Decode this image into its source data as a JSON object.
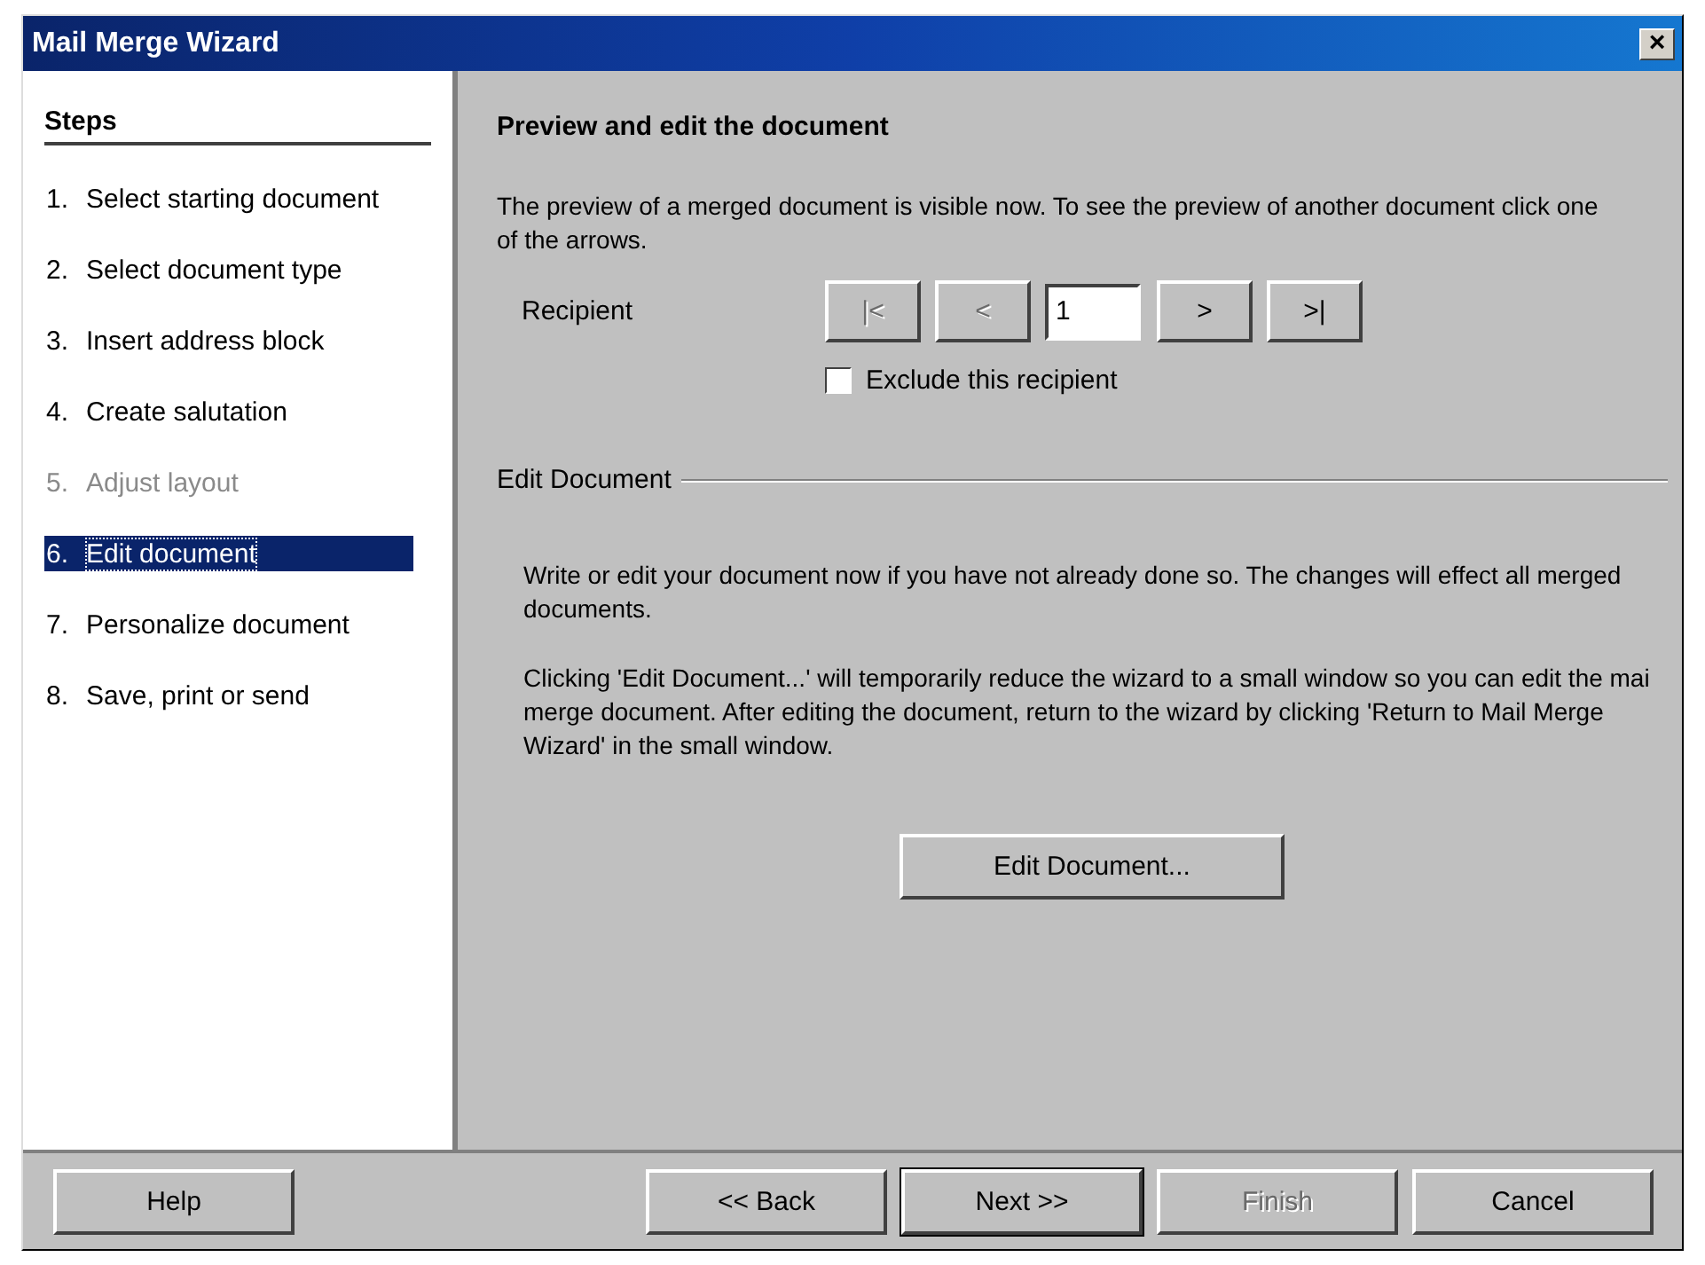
{
  "window": {
    "title": "Mail Merge Wizard",
    "close": "×"
  },
  "steps": {
    "title": "Steps",
    "items": [
      {
        "number": "1.",
        "label": "Select starting document",
        "selected": false,
        "disabled": false
      },
      {
        "number": "2.",
        "label": "Select document type",
        "selected": false,
        "disabled": false
      },
      {
        "number": "3.",
        "label": "Insert address block",
        "selected": false,
        "disabled": false
      },
      {
        "number": "4.",
        "label": "Create salutation",
        "selected": false,
        "disabled": false
      },
      {
        "number": "5.",
        "label": "Adjust layout",
        "selected": false,
        "disabled": true
      },
      {
        "number": "6.",
        "label": "Edit document",
        "selected": true,
        "disabled": false
      },
      {
        "number": "7.",
        "label": "Personalize document",
        "selected": false,
        "disabled": false
      },
      {
        "number": "8.",
        "label": "Save, print or send",
        "selected": false,
        "disabled": false
      }
    ]
  },
  "content": {
    "heading": "Preview and edit the document",
    "intro": "The preview of a merged document is visible now. To see the preview of another document click one\nof the arrows.",
    "recipient": {
      "label": "Recipient",
      "value": "1",
      "nav_buttons": [
        {
          "label": "|<",
          "disabled": true
        },
        {
          "label": "<",
          "disabled": true
        },
        {
          "label": ">",
          "disabled": false
        },
        {
          "label": ">|",
          "disabled": false
        }
      ]
    },
    "exclude": {
      "label": "Exclude this recipient",
      "checked": false
    },
    "group_title": "Edit Document",
    "paragraphs": [
      "Write or edit your document now if you have not already done so. The changes will effect all merged\ndocuments.",
      "Clicking 'Edit Document...' will temporarily reduce the wizard to a small window so you can edit the mai\nmerge document. After editing the document, return to the wizard by clicking 'Return to Mail Merge\nWizard' in the small window."
    ],
    "edit_button": "Edit Document..."
  },
  "buttons": [
    {
      "label": "Help",
      "disabled": false,
      "default": false
    },
    {
      "label": "<< Back",
      "disabled": false,
      "default": false
    },
    {
      "label": "Next >>",
      "disabled": false,
      "default": true
    },
    {
      "label": "Finish",
      "disabled": true,
      "default": false
    },
    {
      "label": "Cancel",
      "disabled": false,
      "default": false
    }
  ]
}
